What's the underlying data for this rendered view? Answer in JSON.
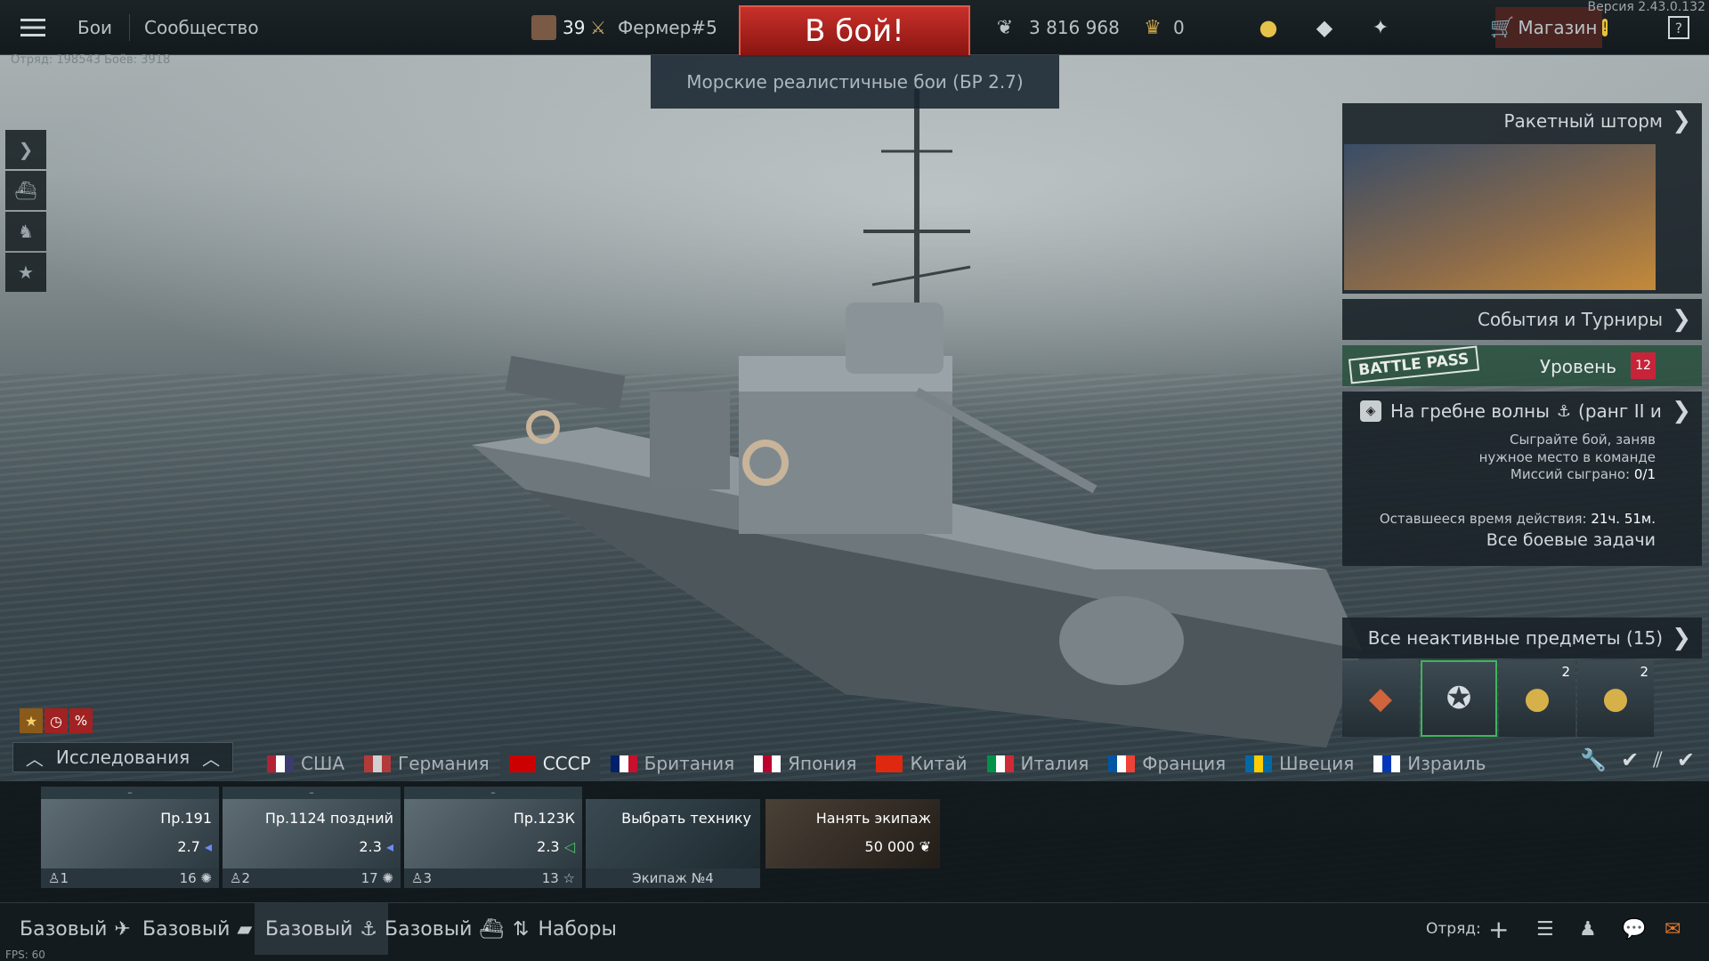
{
  "version": "Версия 2.43.0.132",
  "session": "Отряд: 198543 Боёв: 3918",
  "topbar": {
    "menu_icon": "hamburger-icon",
    "battles": "Бои",
    "community": "Сообщество",
    "level": "39",
    "nickname": "Фермер#5",
    "battle_button": "В бой!",
    "silver": "3 816 968",
    "gold": "0",
    "shop": "Магазин"
  },
  "mode": "Морские реалистичные бои (БР 2.7)",
  "side": {
    "event_title": "Ракетный шторм",
    "events": "События и Турниры",
    "battlepass_badge": "BATTLE PASS",
    "battlepass_level_label": "Уровень",
    "battlepass_level": "12",
    "task_title": "На гребне волны",
    "task_rank": "(ранг II и",
    "task_desc": "Сыграйте бой, заняв нужное место в команде",
    "task_missions_label": "Миссий сыграно:",
    "task_missions": "0/1",
    "task_time_label": "Оставшееся время действия:",
    "task_time": "21ч. 51м.",
    "all_tasks": "Все боевые задачи",
    "inactive": "Все неактивные предметы (15)",
    "items": [
      {
        "count": ""
      },
      {
        "count": ""
      },
      {
        "count": "2"
      },
      {
        "count": "2"
      }
    ]
  },
  "research": "Исследования",
  "nations": [
    {
      "name": "США",
      "colors": [
        "#b22234",
        "#ffffff",
        "#3c3b6e"
      ],
      "selected": false
    },
    {
      "name": "Германия",
      "colors": [
        "#b33a3a",
        "#d0d0d0",
        "#b33a3a"
      ],
      "selected": false
    },
    {
      "name": "СССР",
      "colors": [
        "#cc0000",
        "#cc0000",
        "#cc0000"
      ],
      "selected": true
    },
    {
      "name": "Британия",
      "colors": [
        "#012169",
        "#ffffff",
        "#c8102e"
      ],
      "selected": false
    },
    {
      "name": "Япония",
      "colors": [
        "#ffffff",
        "#bc002d",
        "#ffffff"
      ],
      "selected": false
    },
    {
      "name": "Китай",
      "colors": [
        "#de2910",
        "#de2910",
        "#de2910"
      ],
      "selected": false
    },
    {
      "name": "Италия",
      "colors": [
        "#009246",
        "#ffffff",
        "#ce2b37"
      ],
      "selected": false
    },
    {
      "name": "Франция",
      "colors": [
        "#0055a4",
        "#ffffff",
        "#ef4135"
      ],
      "selected": false
    },
    {
      "name": "Швеция",
      "colors": [
        "#006aa7",
        "#fecc00",
        "#006aa7"
      ],
      "selected": false
    },
    {
      "name": "Израиль",
      "colors": [
        "#ffffff",
        "#0038b8",
        "#ffffff"
      ],
      "selected": false
    }
  ],
  "slots": [
    {
      "name": "Пр.191",
      "br": "2.7",
      "crew": "1",
      "count": "16"
    },
    {
      "name": "Пр.1124 поздний",
      "br": "2.3",
      "crew": "2",
      "count": "17"
    },
    {
      "name": "Пр.123К",
      "br": "2.3",
      "crew": "3",
      "count": "13"
    }
  ],
  "choose": "Выбрать технику",
  "crew_label": "Экипаж №4",
  "hire": "Нанять экипаж",
  "hire_cost": "50 000",
  "bottom": {
    "presets": [
      "Базовый",
      "Базовый",
      "Базовый",
      "Базовый"
    ],
    "kits": "Наборы",
    "squad": "Отряд:",
    "fps": "FPS: 60"
  }
}
